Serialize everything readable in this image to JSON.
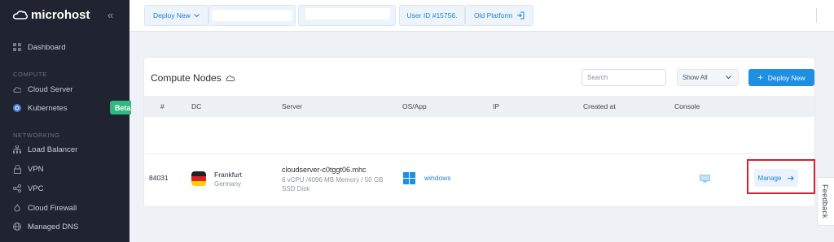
{
  "brand": {
    "name": "microhost"
  },
  "sidebar": {
    "collapse_glyph": "«",
    "items_main": [
      {
        "label": "Dashboard",
        "icon": "dashboard-icon"
      }
    ],
    "section_compute": "COMPUTE",
    "items_compute": [
      {
        "label": "Cloud Server",
        "icon": "cloud-icon"
      },
      {
        "label": "Kubernetes",
        "icon": "kubernetes-icon",
        "badge": "Beta"
      }
    ],
    "section_networking": "NETWORKING",
    "items_networking": [
      {
        "label": "Load Balancer",
        "icon": "load-balancer-icon"
      },
      {
        "label": "VPN",
        "icon": "lock-icon"
      },
      {
        "label": "VPC",
        "icon": "share-nodes-icon"
      },
      {
        "label": "Cloud Firewall",
        "icon": "firewall-icon"
      },
      {
        "label": "Managed DNS",
        "icon": "globe-icon"
      }
    ]
  },
  "topbar": {
    "deploy_new": "Deploy New",
    "user_id": "User ID #15756.",
    "old_platform": "Old Platform"
  },
  "card": {
    "title": "Compute Nodes",
    "search_placeholder": "Search",
    "filter_value": "Show All",
    "deploy_button": "Deploy New",
    "columns": [
      "#",
      "DC",
      "Server",
      "OS/App",
      "IP",
      "Created at",
      "Console"
    ],
    "row": {
      "id": "84031",
      "dc_city": "Frankfurt",
      "dc_country": "Germany",
      "server_name": "cloudserver-c0tggt06.mhc",
      "server_spec_line1": "6 vCPU /4096 MB Memory / 50 GB",
      "server_spec_line2": "SSD Disk",
      "os": "windows",
      "manage_button": "Manage"
    }
  },
  "feedback_tab": "Feedback",
  "colors": {
    "accent": "#1e8fe3",
    "sidebar": "#1f2430",
    "badge": "#2fb981",
    "highlight": "#d81e2c"
  }
}
